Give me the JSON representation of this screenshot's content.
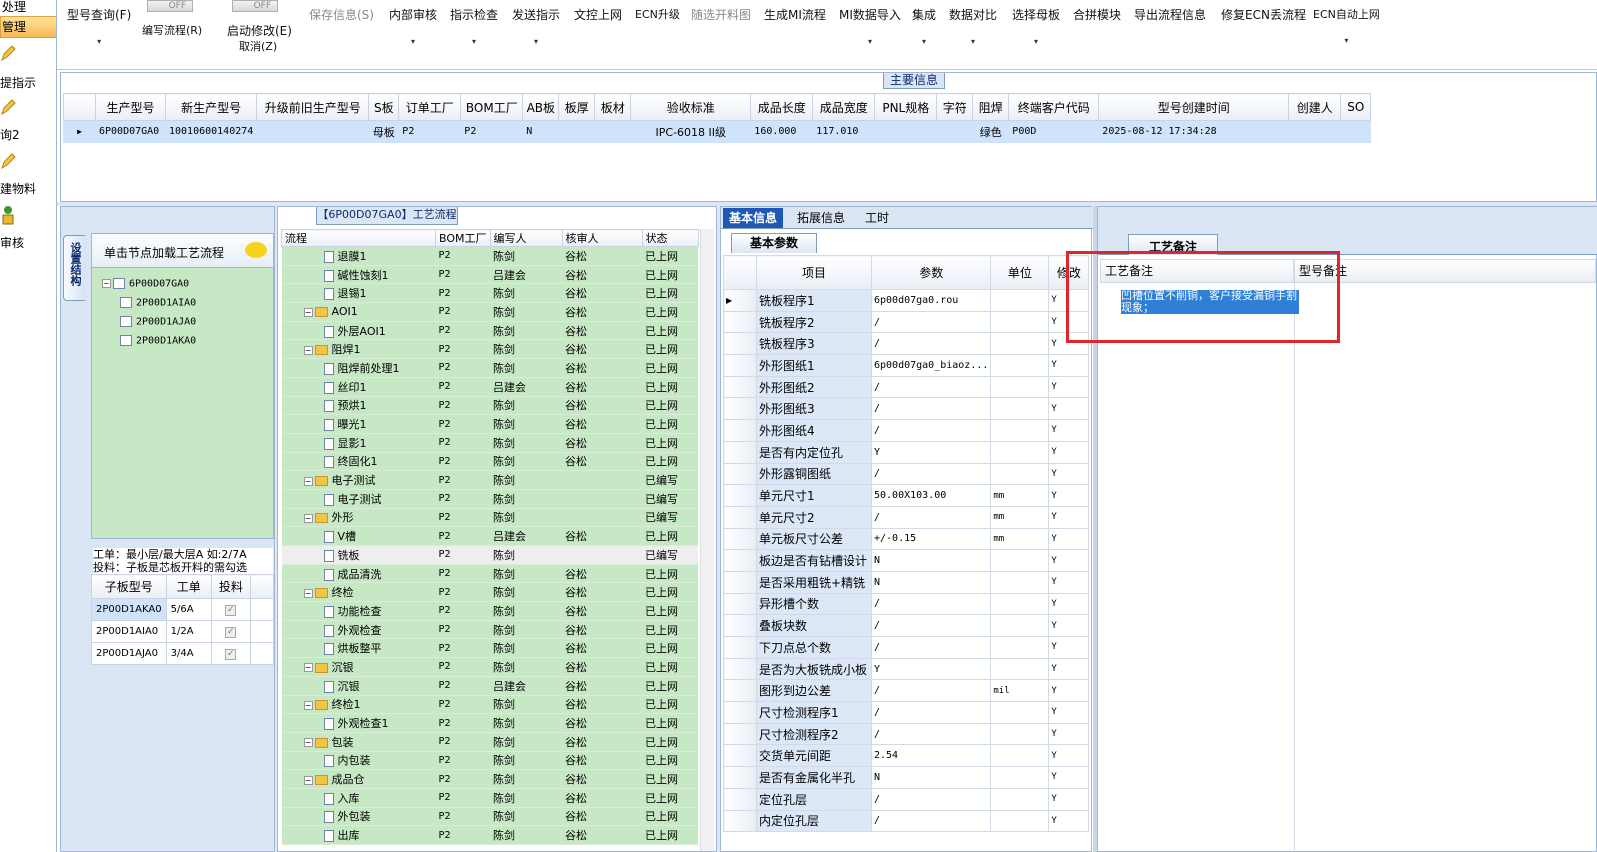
{
  "left_nav": {
    "header": "处理",
    "selected": "管理",
    "items": [
      "提指示",
      "询2",
      "建物料",
      "审核"
    ]
  },
  "toolbar": {
    "buttons": [
      {
        "label": "型号查询(F)",
        "dropdown": true
      },
      {
        "label": "编写流程(R)",
        "toggle": "OFF"
      },
      {
        "label": "启动修改(E)",
        "sub": "取消(Z)",
        "toggle": "OFF"
      },
      {
        "label": "保存信息(S)",
        "disabled": true
      },
      {
        "label": "内部审核",
        "dropdown": true
      },
      {
        "label": "指示检查",
        "dropdown": true
      },
      {
        "label": "发送指示",
        "dropdown": true
      },
      {
        "label": "文控上网"
      },
      {
        "label": "ECN升级"
      },
      {
        "label": "随选开料图",
        "disabled": true
      },
      {
        "label": "生成MI流程"
      },
      {
        "label": "MI数据导入",
        "dropdown": true
      },
      {
        "label": "集成",
        "dropdown": true
      },
      {
        "label": "数据对比",
        "dropdown": true
      },
      {
        "label": "选择母板",
        "dropdown": true
      },
      {
        "label": "合拼模块"
      },
      {
        "label": "导出流程信息"
      },
      {
        "label": "修复ECN丢流程"
      },
      {
        "label": "ECN自动上网",
        "dropdown": true
      }
    ]
  },
  "main_info": {
    "title": "主要信息",
    "columns": [
      "生产型号",
      "新生产型号",
      "升级前旧生产型号",
      "S板",
      "订单工厂",
      "BOM工厂",
      "AB板",
      "板厚",
      "板材",
      "验收标准",
      "成品长度",
      "成品宽度",
      "PNL规格",
      "字符",
      "阻焊",
      "终端客户代码",
      "型号创建时间",
      "创建人",
      "SO"
    ],
    "row": [
      "6P00D07GA0",
      "10010600140274",
      "",
      "母板",
      "P2",
      "P2",
      "N",
      "",
      "",
      "IPC-6018 II级",
      "160.000",
      "117.010",
      "",
      "",
      "绿色",
      "P00D",
      "2025-08-12 17:34:28",
      "",
      ""
    ]
  },
  "left_tree": {
    "vertical_tab": "设置结构",
    "header": "单击节点加载工艺流程",
    "root": "6P00D07GA0",
    "children": [
      "2P00D1AIA0",
      "2P00D1AJA0",
      "2P00D1AKA0"
    ],
    "note_line1": "工单：最小层/最大层A 如:2/7A",
    "note_line2": "投料：子板是芯板开料的需勾选",
    "bom_columns": [
      "子板型号",
      "工单",
      "投料"
    ],
    "bom_rows": [
      {
        "model": "2P00D1AKA0",
        "order": "5/6A"
      },
      {
        "model": "2P00D1AIA0",
        "order": "1/2A"
      },
      {
        "model": "2P00D1AJA0",
        "order": "3/4A"
      }
    ]
  },
  "flow": {
    "title": "【6P00D07GA0】工艺流程",
    "columns": [
      "流程",
      "BOM工厂",
      "编写人",
      "核审人",
      "状态"
    ],
    "rows": [
      {
        "name": "退膜1",
        "type": "doc",
        "bom": "P2",
        "writer": "陈剑",
        "reviewer": "谷松",
        "status": "已上网"
      },
      {
        "name": "碱性蚀刻1",
        "type": "doc",
        "bom": "P2",
        "writer": "吕建会",
        "reviewer": "谷松",
        "status": "已上网"
      },
      {
        "name": "退锡1",
        "type": "doc",
        "bom": "P2",
        "writer": "陈剑",
        "reviewer": "谷松",
        "status": "已上网"
      },
      {
        "name": "AOI1",
        "type": "folder",
        "bom": "P2",
        "writer": "陈剑",
        "reviewer": "谷松",
        "status": "已上网"
      },
      {
        "name": "外层AOI1",
        "type": "doc",
        "bom": "P2",
        "writer": "陈剑",
        "reviewer": "谷松",
        "status": "已上网"
      },
      {
        "name": "阻焊1",
        "type": "folder",
        "bom": "P2",
        "writer": "陈剑",
        "reviewer": "谷松",
        "status": "已上网"
      },
      {
        "name": "阻焊前处理1",
        "type": "doc",
        "bom": "P2",
        "writer": "陈剑",
        "reviewer": "谷松",
        "status": "已上网"
      },
      {
        "name": "丝印1",
        "type": "doc",
        "bom": "P2",
        "writer": "吕建会",
        "reviewer": "谷松",
        "status": "已上网"
      },
      {
        "name": "预烘1",
        "type": "doc",
        "bom": "P2",
        "writer": "陈剑",
        "reviewer": "谷松",
        "status": "已上网"
      },
      {
        "name": "曝光1",
        "type": "doc",
        "bom": "P2",
        "writer": "陈剑",
        "reviewer": "谷松",
        "status": "已上网"
      },
      {
        "name": "显影1",
        "type": "doc",
        "bom": "P2",
        "writer": "陈剑",
        "reviewer": "谷松",
        "status": "已上网"
      },
      {
        "name": "终固化1",
        "type": "doc",
        "bom": "P2",
        "writer": "陈剑",
        "reviewer": "谷松",
        "status": "已上网"
      },
      {
        "name": "电子测试",
        "type": "folder",
        "bom": "P2",
        "writer": "陈剑",
        "reviewer": "",
        "status": "已编写"
      },
      {
        "name": "电子测试",
        "type": "doc",
        "bom": "P2",
        "writer": "陈剑",
        "reviewer": "",
        "status": "已编写"
      },
      {
        "name": "外形",
        "type": "folder",
        "bom": "P2",
        "writer": "陈剑",
        "reviewer": "",
        "status": "已编写"
      },
      {
        "name": "V槽",
        "type": "doc",
        "bom": "P2",
        "writer": "吕建会",
        "reviewer": "谷松",
        "status": "已上网"
      },
      {
        "name": "铣板",
        "type": "doc",
        "bom": "P2",
        "writer": "陈剑",
        "reviewer": "",
        "status": "已编写",
        "selected": true
      },
      {
        "name": "成品清洗",
        "type": "doc",
        "bom": "P2",
        "writer": "陈剑",
        "reviewer": "谷松",
        "status": "已上网"
      },
      {
        "name": "终检",
        "type": "folder",
        "bom": "P2",
        "writer": "陈剑",
        "reviewer": "谷松",
        "status": "已上网"
      },
      {
        "name": "功能检查",
        "type": "doc",
        "bom": "P2",
        "writer": "陈剑",
        "reviewer": "谷松",
        "status": "已上网"
      },
      {
        "name": "外观检查",
        "type": "doc",
        "bom": "P2",
        "writer": "陈剑",
        "reviewer": "谷松",
        "status": "已上网"
      },
      {
        "name": "烘板整平",
        "type": "doc",
        "bom": "P2",
        "writer": "陈剑",
        "reviewer": "谷松",
        "status": "已上网"
      },
      {
        "name": "沉银",
        "type": "folder",
        "bom": "P2",
        "writer": "陈剑",
        "reviewer": "谷松",
        "status": "已上网"
      },
      {
        "name": "沉银",
        "type": "doc",
        "bom": "P2",
        "writer": "吕建会",
        "reviewer": "谷松",
        "status": "已上网"
      },
      {
        "name": "终检1",
        "type": "folder",
        "bom": "P2",
        "writer": "陈剑",
        "reviewer": "谷松",
        "status": "已上网"
      },
      {
        "name": "外观检查1",
        "type": "doc",
        "bom": "P2",
        "writer": "陈剑",
        "reviewer": "谷松",
        "status": "已上网"
      },
      {
        "name": "包装",
        "type": "folder",
        "bom": "P2",
        "writer": "陈剑",
        "reviewer": "谷松",
        "status": "已上网"
      },
      {
        "name": "内包装",
        "type": "doc",
        "bom": "P2",
        "writer": "陈剑",
        "reviewer": "谷松",
        "status": "已上网"
      },
      {
        "name": "成品仓",
        "type": "folder",
        "bom": "P2",
        "writer": "陈剑",
        "reviewer": "谷松",
        "status": "已上网"
      },
      {
        "name": "入库",
        "type": "doc",
        "bom": "P2",
        "writer": "陈剑",
        "reviewer": "谷松",
        "status": "已上网"
      },
      {
        "name": "外包装",
        "type": "doc",
        "bom": "P2",
        "writer": "陈剑",
        "reviewer": "谷松",
        "status": "已上网"
      },
      {
        "name": "出库",
        "type": "doc",
        "bom": "P2",
        "writer": "陈剑",
        "reviewer": "谷松",
        "status": "已上网"
      }
    ]
  },
  "basic": {
    "tabs": [
      "基本信息",
      "拓展信息",
      "工时"
    ],
    "subtab": "基本参数",
    "columns": [
      "项目",
      "参数",
      "单位",
      "修改"
    ],
    "rows": [
      {
        "item": "铣板程序1",
        "param": "6p00d07ga0.rou",
        "unit": "",
        "mod": "Y"
      },
      {
        "item": "铣板程序2",
        "param": "/",
        "unit": "",
        "mod": "Y"
      },
      {
        "item": "铣板程序3",
        "param": "/",
        "unit": "",
        "mod": "Y"
      },
      {
        "item": "外形图纸1",
        "param": "6p00d07ga0_biaoz...",
        "unit": "",
        "mod": "Y"
      },
      {
        "item": "外形图纸2",
        "param": "/",
        "unit": "",
        "mod": "Y"
      },
      {
        "item": "外形图纸3",
        "param": "/",
        "unit": "",
        "mod": "Y"
      },
      {
        "item": "外形图纸4",
        "param": "/",
        "unit": "",
        "mod": "Y"
      },
      {
        "item": "是否有内定位孔",
        "param": "Y",
        "unit": "",
        "mod": "Y"
      },
      {
        "item": "外形露铜图纸",
        "param": "/",
        "unit": "",
        "mod": "Y"
      },
      {
        "item": "单元尺寸1",
        "param": "50.00X103.00",
        "unit": "mm",
        "mod": "Y"
      },
      {
        "item": "单元尺寸2",
        "param": "/",
        "unit": "mm",
        "mod": "Y"
      },
      {
        "item": "单元板尺寸公差",
        "param": "+/-0.15",
        "unit": "mm",
        "mod": "Y"
      },
      {
        "item": "板边是否有钻槽设计",
        "param": "N",
        "unit": "",
        "mod": "Y"
      },
      {
        "item": "是否采用粗铣+精铣",
        "param": "N",
        "unit": "",
        "mod": "Y"
      },
      {
        "item": "异形槽个数",
        "param": "/",
        "unit": "",
        "mod": "Y"
      },
      {
        "item": "叠板块数",
        "param": "/",
        "unit": "",
        "mod": "Y"
      },
      {
        "item": "下刀点总个数",
        "param": "/",
        "unit": "",
        "mod": "Y"
      },
      {
        "item": "是否为大板铣成小板",
        "param": "Y",
        "unit": "",
        "mod": "Y"
      },
      {
        "item": "图形到边公差",
        "param": "/",
        "unit": "mil",
        "mod": "Y"
      },
      {
        "item": "尺寸检测程序1",
        "param": "/",
        "unit": "",
        "mod": "Y"
      },
      {
        "item": "尺寸检测程序2",
        "param": "/",
        "unit": "",
        "mod": "Y"
      },
      {
        "item": "交货单元间距",
        "param": "2.54",
        "unit": "",
        "mod": "Y"
      },
      {
        "item": "是否有金属化半孔",
        "param": "N",
        "unit": "",
        "mod": "Y"
      },
      {
        "item": "定位孔层",
        "param": "/",
        "unit": "",
        "mod": "Y"
      },
      {
        "item": "内定位孔层",
        "param": "/",
        "unit": "",
        "mod": "Y"
      }
    ]
  },
  "remark": {
    "tab": "工艺备注",
    "col1": "工艺备注",
    "col2": "型号备注",
    "text": "凹槽位置不削铜，客户接受漏铜手割现象；"
  },
  "colors": {
    "accent": "#1f57b4",
    "tree_green": "#c7e8c5",
    "highlight": "#e0262b",
    "selection": "#2e7fd6"
  }
}
